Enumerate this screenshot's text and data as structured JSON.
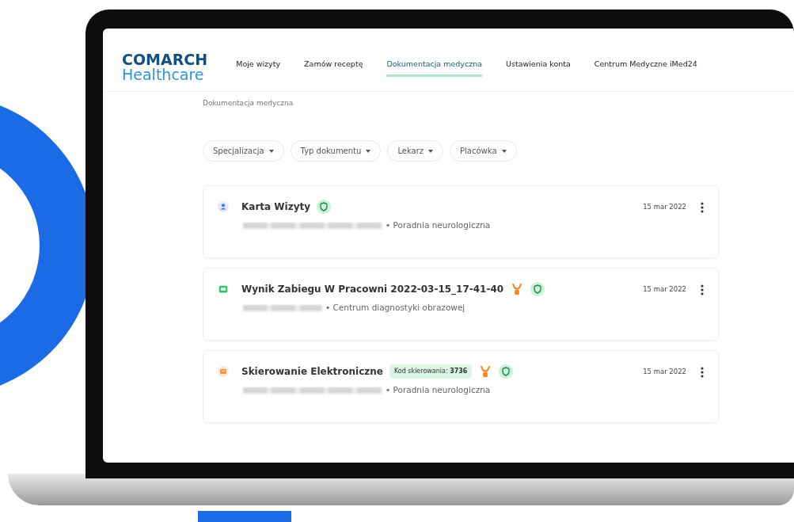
{
  "logo": {
    "line1": "COMARCH",
    "line2": "Healthcare"
  },
  "nav": [
    {
      "label": "Moje wizyty",
      "selected": false
    },
    {
      "label": "Zamów receptę",
      "selected": false
    },
    {
      "label": "Dokumentacja medyczna",
      "selected": true
    },
    {
      "label": "Ustawienia konta",
      "selected": false
    },
    {
      "label": "Centrum Medyczne iMed24",
      "selected": false
    }
  ],
  "breadcrumb": "Dokumentacja medyczna",
  "filters": [
    "Specjalizacja",
    "Typ dokumentu",
    "Lekarz",
    "Placówka"
  ],
  "documents": [
    {
      "kind": "visit",
      "color": "#3d6ff2",
      "title": "Karta Wizyty",
      "cup": false,
      "verified": true,
      "author_hidden": true,
      "place": "• Poradnia neurologiczna",
      "date": "15 mar 2022"
    },
    {
      "kind": "result",
      "color": "#2fc36b",
      "title": "Wynik Zabiegu W Pracowni 2022-03-15_17-41-40",
      "cup": true,
      "verified": true,
      "author_hidden": true,
      "place": "• Centrum diagnostyki obrazowej",
      "date": "15 mar 2022"
    },
    {
      "kind": "referral",
      "color": "#f5923e",
      "title": "Skierowanie Elektroniczne",
      "code_label": "Kod skierowania:",
      "code_value": "3736",
      "cup": true,
      "verified": true,
      "author_hidden": true,
      "place": "• Poradnia neurologiczna",
      "date": "15 mar 2022"
    }
  ]
}
